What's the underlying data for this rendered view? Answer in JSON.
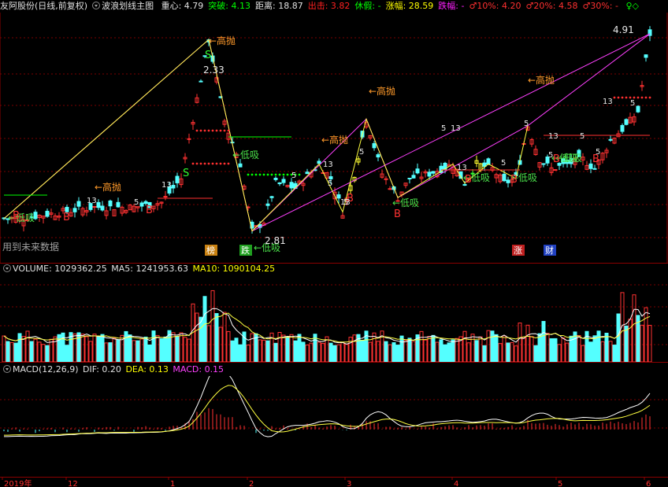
{
  "header": {
    "title": "友阿股份(日线,前复权)",
    "indicator": "波浪划线主图",
    "items": [
      {
        "label": "重心:",
        "value": "4.79",
        "color": "#e0e0e0"
      },
      {
        "label": "突破:",
        "value": "4.13",
        "color": "#00ff00"
      },
      {
        "label": "距离:",
        "value": "18.87",
        "color": "#e0e0e0"
      },
      {
        "label": "出击:",
        "value": "3.82",
        "color": "#ff2020"
      },
      {
        "label": "休假:",
        "value": "-",
        "color": "#00ff00"
      },
      {
        "label": "涨幅:",
        "value": "28.59",
        "color": "#ffff00"
      },
      {
        "label": "跌幅:",
        "value": "-",
        "color": "#ff20ff"
      },
      {
        "label": "♂10%:",
        "value": "4.20",
        "color": "#ff3030"
      },
      {
        "label": "♂20%:",
        "value": "4.58",
        "color": "#ff3030"
      },
      {
        "label": "♂30%:",
        "value": "-",
        "color": "#ff3030"
      },
      {
        "label": "",
        "value": "♀◇",
        "color": "#00ff00"
      }
    ]
  },
  "price": {
    "hi_label": "4.91",
    "lo_label": "2.81",
    "mid_label": "2.33",
    "note": "用到未来数据",
    "tags": {
      "sell": "←高抛",
      "buy": "←低吸",
      "b": "B",
      "s": "S",
      "j": "J",
      "five": "5",
      "thirteen": "13",
      "tops": "榜",
      "fall": "跌",
      "up": "涨",
      "fin": "财"
    }
  },
  "volume": {
    "label": "VOLUME: 1029362.25",
    "ma5": "MA5: 1241953.63",
    "ma10": "MA10: 1090104.25"
  },
  "macd": {
    "label": "MACD(12,26,9)",
    "dif": "DIF: 0.20",
    "dea": "DEA: 0.13",
    "macd": "MACD: 0.15"
  },
  "axis": {
    "labels": [
      "2019年",
      "12",
      "1",
      "2",
      "3",
      "4",
      "5",
      "6"
    ]
  },
  "colors": {
    "up": "#ff3232",
    "down": "#54ffff",
    "line_pink": "#ff40ff",
    "line_yellow": "#ffff40",
    "bg": "#000000",
    "frame": "#8b0000"
  }
}
